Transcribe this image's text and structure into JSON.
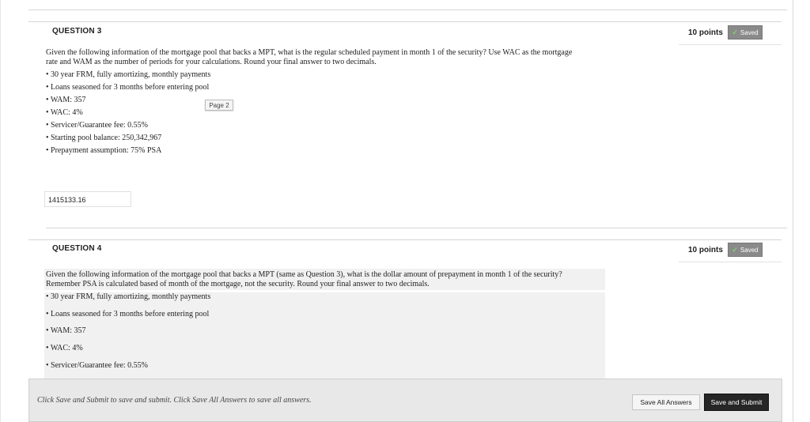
{
  "q3": {
    "title": "QUESTION 3",
    "points": "10 points",
    "saved": "Saved",
    "text_line1": "Given the following information of the mortgage pool that backs a MPT, what is the regular scheduled payment in month 1 of the security? Use WAC as the mortgage",
    "text_line2": "rate and WAM as the number of periods for your calculations. Round your final answer to two decimals.",
    "bullets": [
      "30 year FRM, fully amortizing, monthly payments",
      "Loans seasoned for 3 months before entering pool",
      "WAM: 357",
      "WAC: 4%",
      "Servicer/Guarantee fee: 0.55%",
      "Starting pool balance: 250,342,967",
      "Prepayment assumption: 75% PSA"
    ],
    "answer": "1415133.16",
    "page_tag": "Page 2"
  },
  "q4": {
    "title": "QUESTION 4",
    "points": "10 points",
    "saved": "Saved",
    "text_line1": "Given the following information of the mortgage pool that backs a MPT (same as Question 3), what is the dollar amount of prepayment in month 1 of the security?",
    "text_line2": "Remember PSA is calculated based of month of the mortgage, not the security. Round your final answer to two decimals.",
    "bullets": [
      "30 year FRM, fully amortizing, monthly payments",
      "Loans seasoned for 3 months before entering pool",
      "WAM: 357",
      "WAC: 4%",
      "Servicer/Guarantee fee: 0.55%"
    ]
  },
  "footer": {
    "instructions": "Click Save and Submit to save and submit. Click Save All Answers to save all answers.",
    "save_all": "Save All Answers",
    "save_submit": "Save and Submit"
  }
}
